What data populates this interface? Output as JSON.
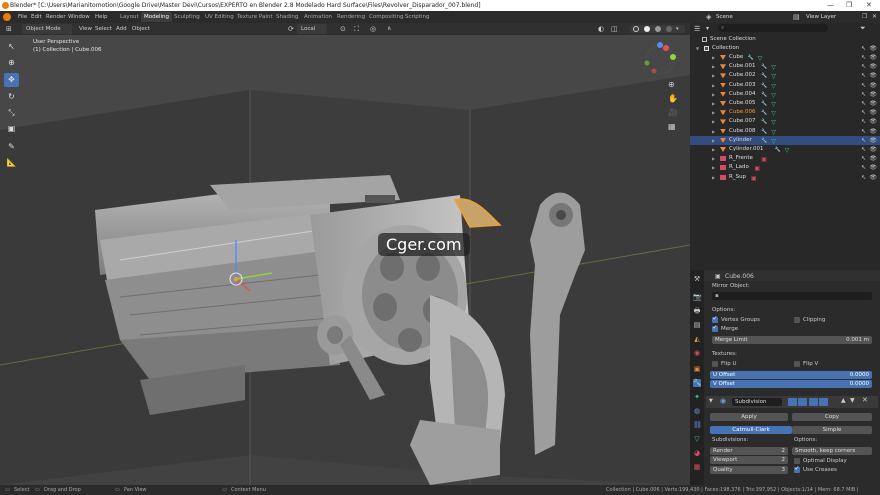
{
  "window": {
    "title": "Blender* [C:\\Users\\Marianitomotion\\Google Drive\\Master Devi\\Cursos\\EXPERTO en Blender 2.8 Modelado Hard Surface\\Files\\Revolver_Disparador_007.blend]",
    "controls": [
      "—",
      "❐",
      "✕"
    ]
  },
  "menu": [
    "File",
    "Edit",
    "Render",
    "Window",
    "Help"
  ],
  "workspaces": [
    {
      "label": "Layout",
      "active": false
    },
    {
      "label": "Modeling",
      "active": true
    },
    {
      "label": "Sculpting",
      "active": false
    },
    {
      "label": "UV Editing",
      "active": false
    },
    {
      "label": "Texture Paint",
      "active": false
    },
    {
      "label": "Shading",
      "active": false
    },
    {
      "label": "Animation",
      "active": false
    },
    {
      "label": "Rendering",
      "active": false
    },
    {
      "label": "Compositing",
      "active": false
    },
    {
      "label": "Scripting",
      "active": false
    }
  ],
  "scene": {
    "label": "Scene",
    "view_layer": "View Layer"
  },
  "viewport_header": {
    "mode": "Object Mode",
    "menus": [
      "View",
      "Select",
      "Add",
      "Object"
    ],
    "orientation": "Local"
  },
  "viewport": {
    "view_name": "User Perspective",
    "collection_info": "(1) Collection | Cube.006",
    "watermark": "Cger.com"
  },
  "outliner": {
    "scene_collection": "Scene Collection",
    "collection": "Collection",
    "objects": [
      {
        "name": "Cube",
        "type": "mesh",
        "selected": false,
        "active": false,
        "mods": [
          "wrench-icon",
          "tri-icon"
        ]
      },
      {
        "name": "Cube.001",
        "type": "mesh",
        "selected": false,
        "active": false,
        "mods": [
          "wrench-icon",
          "tri-icon"
        ]
      },
      {
        "name": "Cube.002",
        "type": "mesh",
        "selected": false,
        "active": false,
        "mods": [
          "wrench-icon",
          "tri-icon"
        ]
      },
      {
        "name": "Cube.003",
        "type": "mesh",
        "selected": false,
        "active": false,
        "mods": [
          "wrench-icon",
          "tri-icon"
        ]
      },
      {
        "name": "Cube.004",
        "type": "mesh",
        "selected": false,
        "active": false,
        "mods": [
          "wrench-icon",
          "tri-icon"
        ]
      },
      {
        "name": "Cube.005",
        "type": "mesh",
        "selected": false,
        "active": false,
        "mods": [
          "wrench-icon",
          "tri-icon"
        ]
      },
      {
        "name": "Cube.006",
        "type": "mesh",
        "selected": false,
        "active": true,
        "mods": [
          "wrench-icon",
          "tri-icon"
        ]
      },
      {
        "name": "Cube.007",
        "type": "mesh",
        "selected": false,
        "active": false,
        "mods": [
          "wrench-icon",
          "tri-icon"
        ]
      },
      {
        "name": "Cube.008",
        "type": "mesh",
        "selected": false,
        "active": false,
        "mods": [
          "wrench-icon",
          "tri-icon"
        ]
      },
      {
        "name": "Cylinder",
        "type": "mesh",
        "selected": true,
        "active": false,
        "mods": [
          "wrench-icon",
          "tri-icon"
        ]
      },
      {
        "name": "Cylinder.001",
        "type": "mesh",
        "selected": false,
        "active": false,
        "mods": [
          "wrench-icon",
          "tri-icon"
        ]
      },
      {
        "name": "R_Frente",
        "type": "image",
        "selected": false,
        "active": false,
        "mods": [
          "image-icon"
        ]
      },
      {
        "name": "R_Lado",
        "type": "image",
        "selected": false,
        "active": false,
        "mods": [
          "image-icon"
        ]
      },
      {
        "name": "R_Sup",
        "type": "image",
        "selected": false,
        "active": false,
        "mods": [
          "image-icon"
        ]
      }
    ]
  },
  "properties": {
    "object_name": "Cube.006",
    "mirror_object_label": "Mirror Object:",
    "options_label": "Options:",
    "vertex_groups": "Vertex Groups",
    "clipping": "Clipping",
    "merge": "Merge",
    "merge_limit_label": "Merge Limit",
    "merge_limit": "0.001 m",
    "textures_label": "Textures:",
    "flip_u": "Flip U",
    "flip_v": "Flip V",
    "u_offset_label": "U Offset",
    "u_offset": "0.0000",
    "v_offset_label": "V Offset",
    "v_offset": "0.0000",
    "modifier_name": "Subdivision",
    "apply": "Apply",
    "copy": "Copy",
    "catmull_clark": "Catmull-Clark",
    "simple": "Simple",
    "subdivisions_label": "Subdivisions:",
    "render_label": "Render",
    "render_value": "2",
    "viewport_label": "Viewport",
    "viewport_value": "2",
    "quality_label": "Quality",
    "quality_value": "3",
    "options2_label": "Options:",
    "uv_smooth": "Smooth, keep corners",
    "optimal_display": "Optimal Display",
    "use_creases": "Use Creases"
  },
  "statusbar": {
    "select": "Select",
    "drag": "Drag and Drop",
    "pan": "Pan View",
    "context": "Context Menu",
    "stats": "Collection | Cube.006 | Verts:199,430 | Faces:198,376 | Tris:397,952 | Objects:1/14 | Mem: 68.7 MiB | v2.80.74"
  },
  "colors": {
    "accent": "#4772b3",
    "active_object": "#f0a030",
    "mesh_icon": "#e8873a",
    "modifier_icon": "#6a9de0",
    "data_icon": "#3fc78e",
    "image_icon": "#d94a64"
  }
}
